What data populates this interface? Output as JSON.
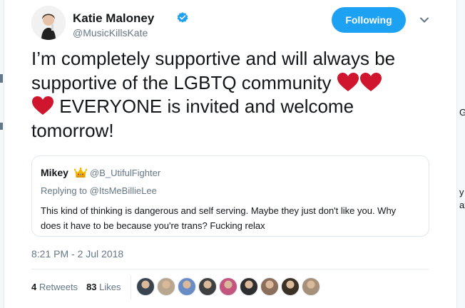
{
  "author": {
    "name": "Katie Maloney",
    "handle": "@MusicKillsKate",
    "verified": true,
    "avatar_icon": "avatar-photo"
  },
  "follow_button": {
    "label": "Following",
    "color": "#1da1f2"
  },
  "menu_icon": "chevron-down-icon",
  "tweet": {
    "line1": "I’m completely supportive and will always be",
    "line2": "supportive of the LGBTQ community",
    "line3": "EVERYONE is invited and welcome",
    "line4": "tomorrow!",
    "emoji": "red-heart",
    "heart_color": "#d0162e"
  },
  "quoted_tweet": {
    "name": "Mikey",
    "badge_icon": "crown-icon",
    "handle": "@B_UtifulFighter",
    "replying_prefix": "Replying to",
    "replying_handle": "@ItsMeBillieLee",
    "text_line1": "This kind of thinking is dangerous and self serving. Maybe they just don't like you. Why",
    "text_line2": "does it have to be because you're trans? Fucking relax"
  },
  "timestamp": "8:21 PM - 2 Jul 2018",
  "stats": {
    "retweets_count": "4",
    "retweets_label": "Retweets",
    "likes_count": "83",
    "likes_label": "Likes"
  },
  "likers": [
    {
      "name": "liker-avatar-1",
      "color": "#3a4450"
    },
    {
      "name": "liker-avatar-2",
      "color": "#b9a68e"
    },
    {
      "name": "liker-avatar-3",
      "color": "#6a8cc4"
    },
    {
      "name": "liker-avatar-4",
      "color": "#404040"
    },
    {
      "name": "liker-avatar-5",
      "color": "#c2567e"
    },
    {
      "name": "liker-avatar-6",
      "color": "#2f2f2f"
    },
    {
      "name": "liker-avatar-7",
      "color": "#8c6f5a"
    },
    {
      "name": "liker-avatar-8",
      "color": "#3b3225"
    },
    {
      "name": "liker-avatar-9",
      "color": "#a5907a"
    }
  ],
  "background_fragments": {
    "right_1": "G",
    "right_2": "y",
    "right_3": "ax"
  }
}
